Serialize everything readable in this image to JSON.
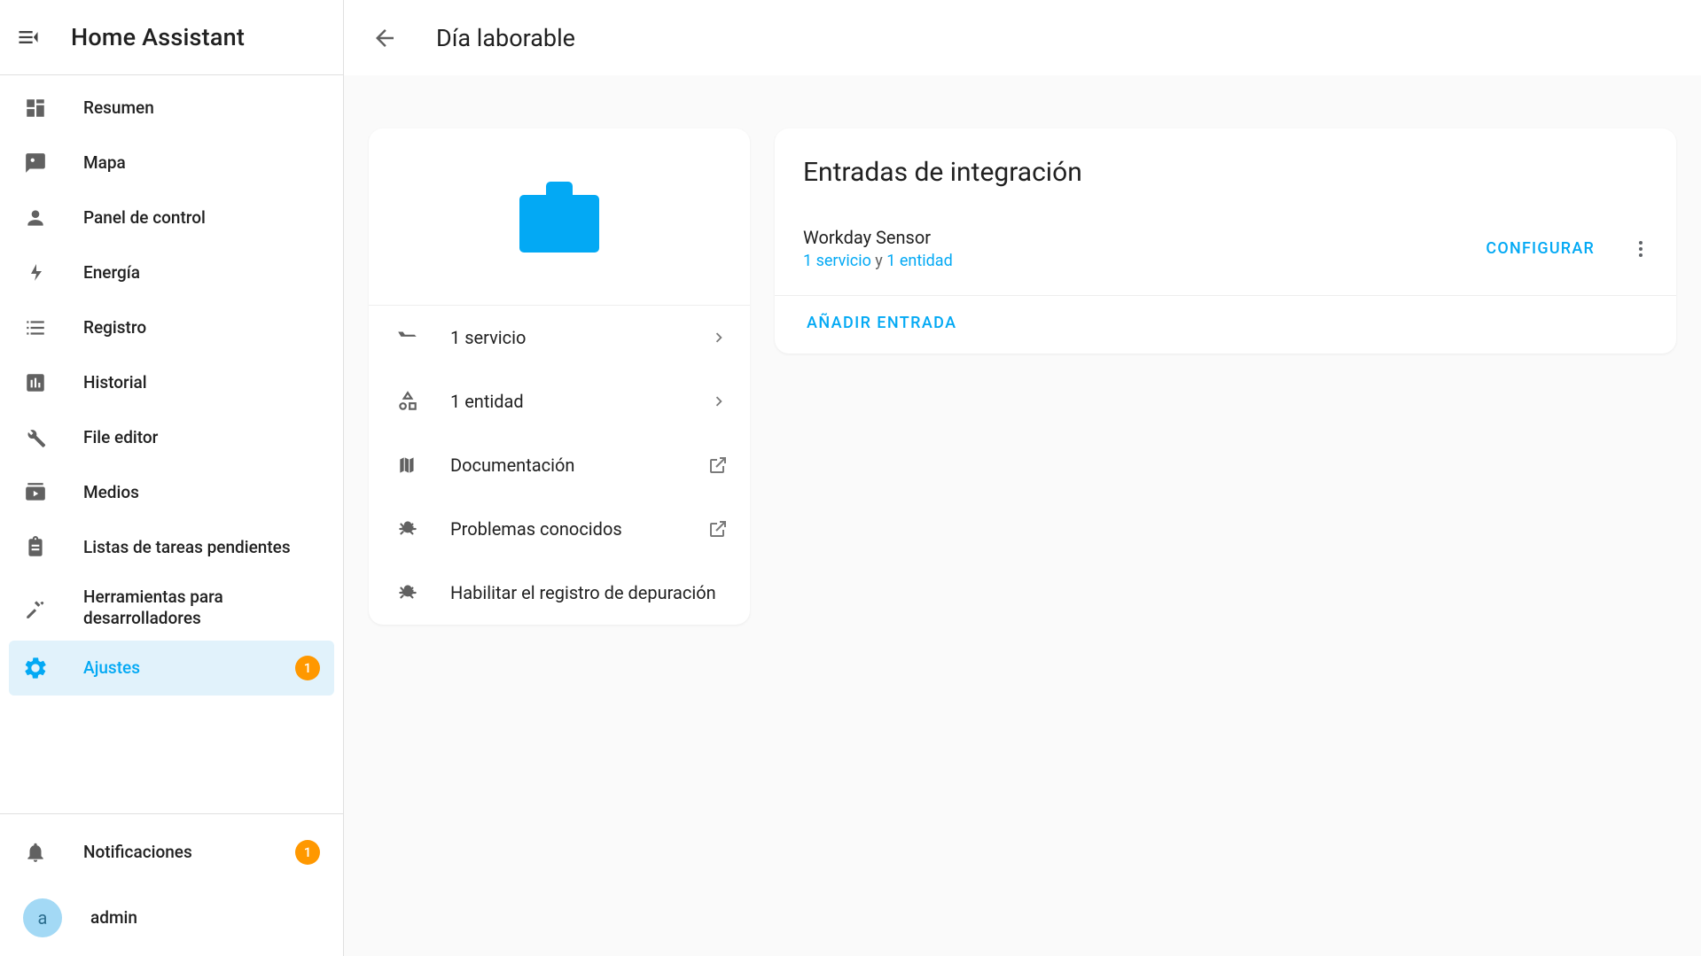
{
  "app": {
    "title": "Home Assistant"
  },
  "sidebar": {
    "items": [
      {
        "label": "Resumen"
      },
      {
        "label": "Mapa"
      },
      {
        "label": "Panel de control"
      },
      {
        "label": "Energía"
      },
      {
        "label": "Registro"
      },
      {
        "label": "Historial"
      },
      {
        "label": "File editor"
      },
      {
        "label": "Medios"
      },
      {
        "label": "Listas de tareas pendientes"
      },
      {
        "label": "Herramientas para desarrolladores"
      },
      {
        "label": "Ajustes",
        "badge": "1",
        "active": true
      }
    ],
    "footer": {
      "notifications": {
        "label": "Notificaciones",
        "badge": "1"
      },
      "user": {
        "label": "admin",
        "initial": "a"
      }
    }
  },
  "header": {
    "title": "Día laborable"
  },
  "left_card": {
    "rows": [
      {
        "label": "1 servicio"
      },
      {
        "label": "1 entidad"
      },
      {
        "label": "Documentación"
      },
      {
        "label": "Problemas conocidos"
      },
      {
        "label": "Habilitar el registro de depuración"
      }
    ]
  },
  "right_card": {
    "title": "Entradas de integración",
    "entry": {
      "name": "Workday Sensor",
      "service_link": "1 servicio",
      "sep": " y ",
      "entity_link": "1 entidad",
      "configure_label": "CONFIGURAR"
    },
    "add_label": "AÑADIR ENTRADA"
  }
}
